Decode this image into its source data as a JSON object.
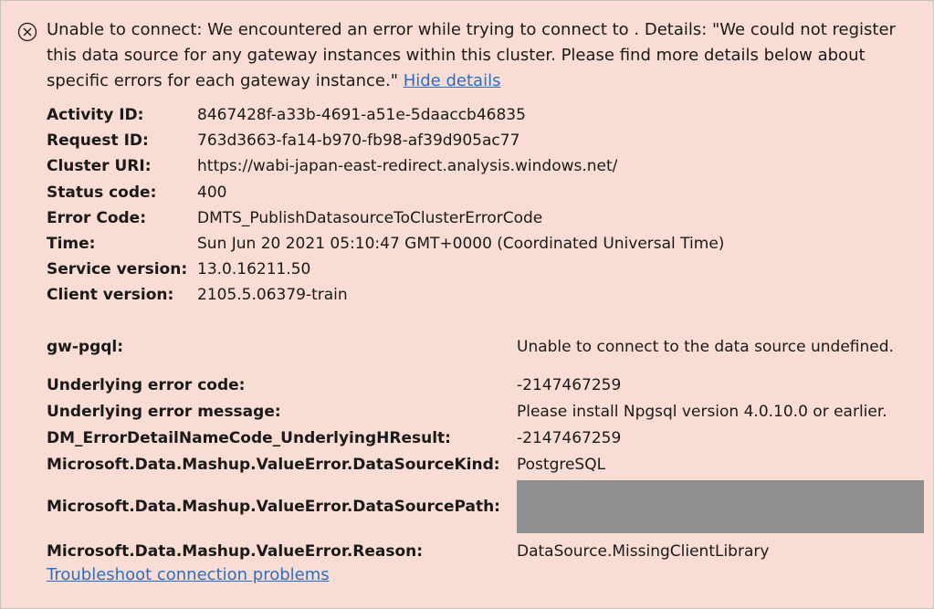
{
  "error": {
    "message": "Unable to connect: We encountered an error while trying to connect to . Details: \"We could not register this data source for any gateway instances within this cluster. Please find more details below about specific errors for each gateway instance.\"",
    "hide_details_link": "Hide details",
    "troubleshoot_link": "Troubleshoot connection problems"
  },
  "details": [
    {
      "label": "Activity ID:",
      "value": "8467428f-a33b-4691-a51e-5daaccb46835"
    },
    {
      "label": "Request ID:",
      "value": "763d3663-fa14-b970-fb98-af39d905ac77"
    },
    {
      "label": "Cluster URI:",
      "value": "https://wabi-japan-east-redirect.analysis.windows.net/"
    },
    {
      "label": "Status code:",
      "value": "400"
    },
    {
      "label": "Error Code:",
      "value": "DMTS_PublishDatasourceToClusterErrorCode"
    },
    {
      "label": "Time:",
      "value": "Sun Jun 20 2021 05:10:47 GMT+0000 (Coordinated Universal Time)"
    },
    {
      "label": "Service version:",
      "value": "13.0.16211.50"
    },
    {
      "label": "Client version:",
      "value": "2105.5.06379-train"
    }
  ],
  "gateway": [
    {
      "label": "gw-pgql:",
      "value": "Unable to connect to the data source undefined."
    },
    {
      "label": "Underlying error code:",
      "value": "-2147467259"
    },
    {
      "label": "Underlying error message:",
      "value": "Please install Npgsql version 4.0.10.0 or earlier."
    },
    {
      "label": "DM_ErrorDetailNameCode_UnderlyingHResult:",
      "value": "-2147467259"
    },
    {
      "label": "Microsoft.Data.Mashup.ValueError.DataSourceKind:",
      "value": "PostgreSQL"
    },
    {
      "label": "Microsoft.Data.Mashup.ValueError.DataSourcePath:",
      "value": ""
    },
    {
      "label": "Microsoft.Data.Mashup.ValueError.Reason:",
      "value": "DataSource.MissingClientLibrary"
    }
  ]
}
